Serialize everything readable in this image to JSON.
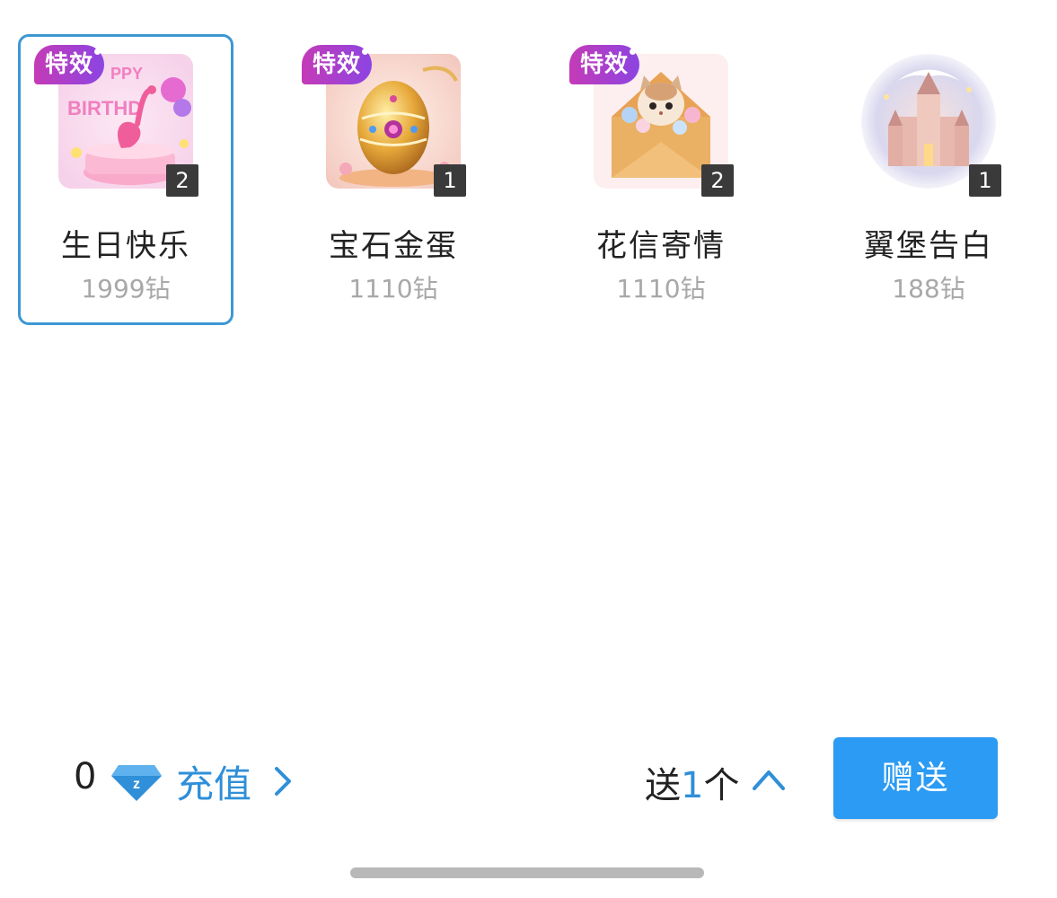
{
  "gifts": [
    {
      "name": "生日快乐",
      "price": "1999钻",
      "count": "2",
      "effect_label": "特效",
      "has_effect": true,
      "selected": true,
      "image": "birthday-flamingo-cake"
    },
    {
      "name": "宝石金蛋",
      "price": "1110钻",
      "count": "1",
      "effect_label": "特效",
      "has_effect": true,
      "selected": false,
      "image": "golden-jeweled-egg"
    },
    {
      "name": "花信寄情",
      "price": "1110钻",
      "count": "2",
      "effect_label": "特效",
      "has_effect": true,
      "selected": false,
      "image": "cat-in-flower-envelope"
    },
    {
      "name": "翼堡告白",
      "price": "188钻",
      "count": "1",
      "effect_label": "",
      "has_effect": false,
      "selected": false,
      "image": "winged-castle"
    }
  ],
  "bottom_bar": {
    "balance": "0",
    "currency_icon": "diamond-icon",
    "recharge_label": "充值",
    "quantity_prefix": "送",
    "quantity_value": "1",
    "quantity_suffix": "个",
    "send_label": "赠送"
  },
  "colors": {
    "accent": "#2b9bf4",
    "link": "#2f8fd8",
    "selected_border": "#3d97d3",
    "effect_badge_start": "#c43bb7",
    "effect_badge_end": "#8c44e2"
  }
}
